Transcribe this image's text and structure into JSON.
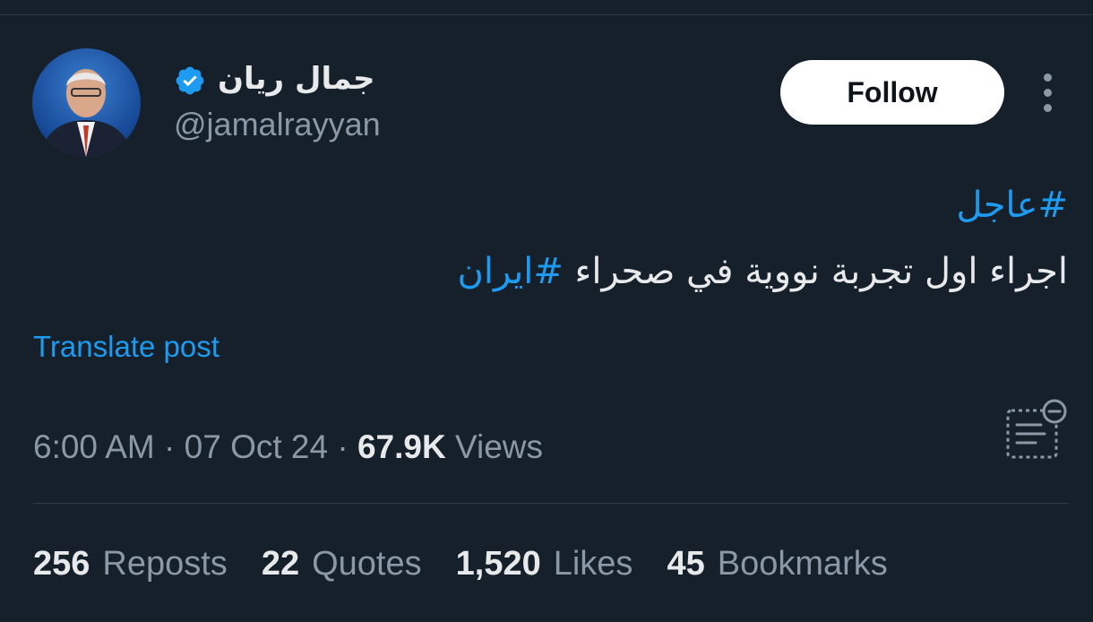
{
  "author": {
    "display_name": "جمال ريان",
    "handle": "@jamalrayyan",
    "verified": true,
    "avatar": "avatar"
  },
  "follow_button": {
    "label": "Follow"
  },
  "more_button": {
    "icon": "more-options-icon"
  },
  "tweet": {
    "line1": "#عاجل",
    "line2_text": "اجراء اول تجربة نووية في صحراء ",
    "line2_hashtag": "#ايران"
  },
  "translate_link": "Translate post",
  "meta": {
    "time": "6:00 AM",
    "separator": "·",
    "date": "07 Oct 24",
    "views_count": "67.9K",
    "views_label": "Views"
  },
  "summary_icon": "grok-summary-icon",
  "stats": [
    {
      "count": "256",
      "label": "Reposts"
    },
    {
      "count": "22",
      "label": "Quotes"
    },
    {
      "count": "1,520",
      "label": "Likes"
    },
    {
      "count": "45",
      "label": "Bookmarks"
    }
  ],
  "colors": {
    "background": "#15202b",
    "accent": "#1d9bf0",
    "muted": "#8b98a5",
    "text": "#e7e9ea"
  }
}
